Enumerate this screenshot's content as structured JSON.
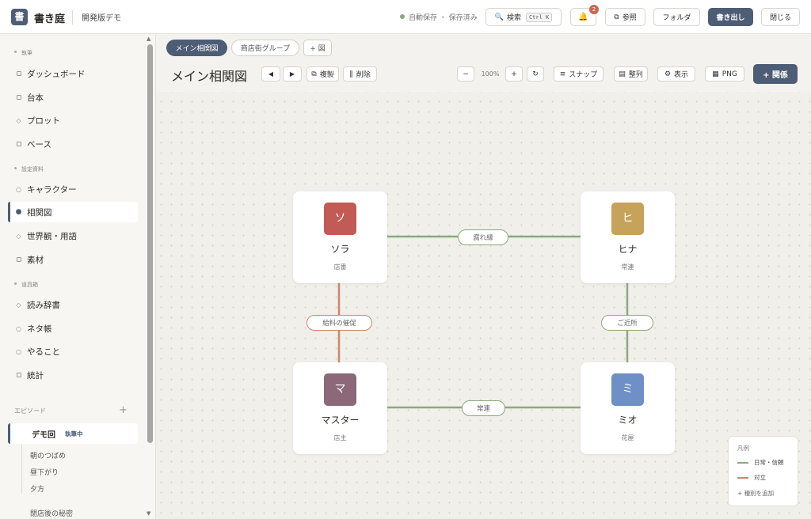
{
  "header": {
    "logo_char": "書",
    "app_title": "書き庭",
    "project_name": "開発版デモ",
    "save_status": "自動保存 ・ 保存済み",
    "search_label": "検索",
    "search_shortcut": "Ctrl K",
    "notification_count": "2",
    "reference_label": "参照",
    "folder_label": "フォルダ",
    "export_label": "書き出し",
    "close_label": "閉じる"
  },
  "sidebar": {
    "sections": [
      "執筆",
      "設定資料",
      "道具箱"
    ],
    "items": [
      {
        "label": "ダッシュボード",
        "icon": "square-icon"
      },
      {
        "label": "台本",
        "icon": "square-icon"
      },
      {
        "label": "プロット",
        "icon": "diamond-icon"
      },
      {
        "label": "ベース",
        "icon": "square-icon"
      },
      {
        "label": "キャラクター",
        "icon": "circle-icon"
      },
      {
        "label": "相関図",
        "icon": "filled-dot-icon"
      },
      {
        "label": "世界観・用語",
        "icon": "diamond-icon"
      },
      {
        "label": "素材",
        "icon": "square-icon"
      },
      {
        "label": "読み辞書",
        "icon": "diamond-icon"
      },
      {
        "label": "ネタ帳",
        "icon": "circle-icon"
      },
      {
        "label": "やること",
        "icon": "circle-icon"
      },
      {
        "label": "統計",
        "icon": "square-icon"
      }
    ],
    "episodes_label": "エピソード",
    "episode_add": "+",
    "current_episode": {
      "title": "デモ回",
      "status": "執筆中"
    },
    "sub_episodes": [
      "朝のつばめ",
      "昼下がり",
      "夕方"
    ],
    "next_episode": "閉店後の秘密"
  },
  "toolbar": {
    "tabs": [
      "メイン相関図",
      "商店街グループ",
      "+ 図"
    ],
    "page_title": "メイン相関図",
    "prev_icon": "◀",
    "next_icon": "▶",
    "duplicate_label": "複製",
    "delete_label": "削除",
    "zoom_out": "−",
    "zoom_level": "100%",
    "zoom_in": "+",
    "reset_icon": "↻",
    "snap_label": "スナップ",
    "arrange_label": "整列",
    "display_label": "表示",
    "png_label": "PNG",
    "add_relation_label": "+ 関係"
  },
  "colors": {
    "accent": "#4e5d76",
    "bond": "#8aaa7e",
    "conflict": "#c9876a"
  },
  "graph": {
    "nodes": [
      {
        "initial": "ソ",
        "name": "ソラ",
        "role": "店番",
        "color": "#c25a55"
      },
      {
        "initial": "ヒ",
        "name": "ヒナ",
        "role": "常連",
        "color": "#c6a25a"
      },
      {
        "initial": "マ",
        "name": "マスター",
        "role": "店主",
        "color": "#8c6878"
      },
      {
        "initial": "ミ",
        "name": "ミオ",
        "role": "花屋",
        "color": "#6f8fc7"
      }
    ],
    "edges": [
      {
        "label": "腐れ縁",
        "type": "bond"
      },
      {
        "label": "給料の催促",
        "type": "conflict"
      },
      {
        "label": "ご近所",
        "type": "bond"
      },
      {
        "label": "常連",
        "type": "bond"
      }
    ]
  },
  "legend": {
    "title": "凡例",
    "items": [
      {
        "label": "日常・信頼",
        "color": "#8aaa7e"
      },
      {
        "label": "対立",
        "color": "#c9876a"
      }
    ],
    "add_label": "+ 種別を追加"
  }
}
